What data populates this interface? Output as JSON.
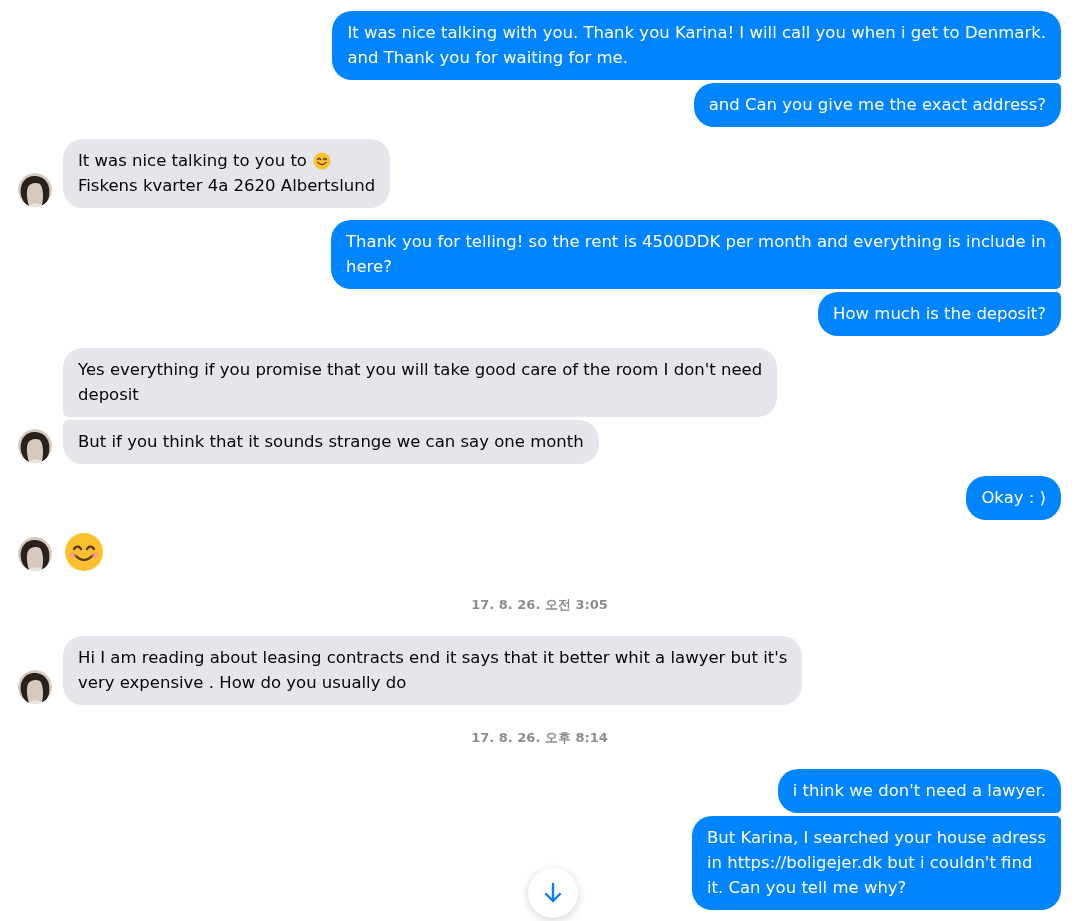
{
  "conversation": [
    {
      "kind": "sent",
      "messages": [
        {
          "kind": "text",
          "lines": [
            "It was nice talking with you. Thank you Karina! I will call you when i get to Denmark.",
            "and Thank you for waiting for me."
          ]
        },
        {
          "kind": "text",
          "lines": [
            "and Can you give me the exact address?"
          ]
        }
      ]
    },
    {
      "kind": "received",
      "messages": [
        {
          "kind": "text_with_emoji",
          "lines": [
            "It was nice talking to you to",
            "Fiskens kvarter 4a 2620 Albertslund"
          ]
        }
      ]
    },
    {
      "kind": "sent",
      "messages": [
        {
          "kind": "text",
          "lines": [
            "Thank you for telling! so the rent is 4500DDK per month and everything is include in",
            "here?"
          ]
        },
        {
          "kind": "text",
          "lines": [
            "How much is the deposit?"
          ]
        }
      ]
    },
    {
      "kind": "received",
      "messages": [
        {
          "kind": "text",
          "lines": [
            "Yes everything if you promise that you will take good care of the room I don't need",
            "deposit"
          ]
        },
        {
          "kind": "text",
          "lines": [
            "But if you think that it sounds strange we can say one month"
          ]
        }
      ]
    },
    {
      "kind": "sent",
      "messages": [
        {
          "kind": "text",
          "lines": [
            "Okay : )"
          ]
        }
      ]
    },
    {
      "kind": "received",
      "messages": [
        {
          "kind": "emoji"
        }
      ]
    },
    {
      "kind": "timestamp",
      "text": "17. 8. 26. 오전 3:05"
    },
    {
      "kind": "received",
      "messages": [
        {
          "kind": "text",
          "lines": [
            "Hi I am reading about leasing contracts end it says that it better whit a lawyer but it's",
            "very expensive . How do you usually do"
          ]
        }
      ]
    },
    {
      "kind": "timestamp",
      "text": "17. 8. 26. 오후 8:14"
    },
    {
      "kind": "sent",
      "messages": [
        {
          "kind": "text",
          "lines": [
            "i think we don't need a lawyer."
          ]
        },
        {
          "kind": "text",
          "lines": [
            "But Karina, I searched your house adress",
            "in https://boligejer.dk but i couldn't find",
            "it. Can you tell me why?"
          ]
        }
      ]
    }
  ]
}
